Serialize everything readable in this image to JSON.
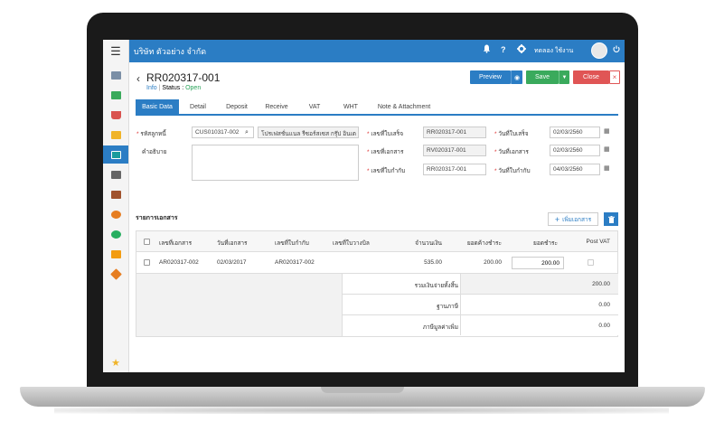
{
  "topbar": {
    "company": "บริษัท ตัวอย่าง จำกัด",
    "user_name": "ทดลอง ใช้งาน",
    "icons": [
      "bell-icon",
      "help-icon",
      "gear-icon",
      "power-icon"
    ]
  },
  "sidebar": {
    "items": [
      {
        "icon": "dashboard-icon",
        "color": "#7b8fa6"
      },
      {
        "icon": "money-icon",
        "color": "#3aaa5c"
      },
      {
        "icon": "cart-icon",
        "color": "#d9534f"
      },
      {
        "icon": "box-icon",
        "color": "#f0b429"
      },
      {
        "icon": "receivable-icon",
        "color": "#1a9c9c",
        "active": true
      },
      {
        "icon": "bank-icon",
        "color": "#666666"
      },
      {
        "icon": "wallet-icon",
        "color": "#c0392b"
      },
      {
        "icon": "asset-icon",
        "color": "#e67e22"
      },
      {
        "icon": "check-icon",
        "color": "#27ae60"
      },
      {
        "icon": "report-icon",
        "color": "#f39c12"
      },
      {
        "icon": "tools-icon",
        "color": "#e67e22"
      },
      {
        "icon": "star-icon",
        "color": "#f0b429"
      }
    ]
  },
  "header": {
    "doc_no": "RR020317-001",
    "info_label": "Info",
    "status_label": "Status :",
    "status_value": "Open"
  },
  "actions": {
    "preview": "Preview",
    "save": "Save",
    "close": "Close"
  },
  "tabs": [
    "Basic Data",
    "Detail",
    "Deposit",
    "Receive",
    "VAT",
    "WHT",
    "Note & Attachment"
  ],
  "form": {
    "customer_code_label": "รหัสลูกหนี้",
    "customer_code": "CUS010317-002",
    "customer_name": "โปรเฟสชั่นแนล รีซอร์สเซส กรุ๊ป อินเต",
    "description_label": "คำอธิบาย",
    "receipt_no_label": "เลขที่ใบเสร็จ",
    "receipt_no": "RR020317-001",
    "doc_no_label": "เลขที่เอกสาร",
    "doc_no": "RV020317-001",
    "invoice_no_label": "เลขที่ใบกำกับ",
    "invoice_no": "RR020317-001",
    "receipt_date_label": "วันที่ใบเสร็จ",
    "receipt_date": "02/03/2560",
    "doc_date_label": "วันที่เอกสาร",
    "doc_date": "02/03/2560",
    "invoice_date_label": "วันที่ใบกำกับ",
    "invoice_date": "04/03/2560"
  },
  "items": {
    "title": "รายการเอกสาร",
    "add_label": "เพิ่มเอกสาร",
    "columns": [
      "เลขที่เอกสาร",
      "วันที่เอกสาร",
      "เลขที่ใบกำกับ",
      "เลขที่ใบวางบิล",
      "จำนวนเงิน",
      "ยอดค้างชำระ",
      "ยอดชำระ",
      "Post VAT"
    ],
    "rows": [
      {
        "doc_no": "AR020317-002",
        "doc_date": "02/03/2017",
        "invoice_no": "AR020317-002",
        "billing_no": "",
        "amount": "535.00",
        "outstanding": "200.00",
        "paid": "200.00"
      }
    ]
  },
  "summary": {
    "total_label": "รวมเงินจ่ายทั้งสิ้น",
    "total": "200.00",
    "tax_base_label": "ฐานภาษี",
    "tax_base": "0.00",
    "vat_label": "ภาษีมูลค่าเพิ่ม",
    "vat": "0.00"
  }
}
